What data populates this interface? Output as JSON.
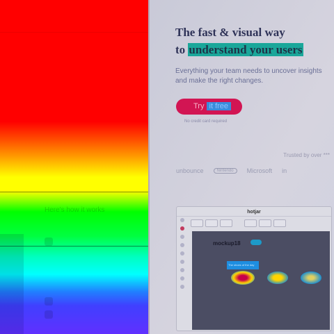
{
  "left_panel": {
    "section_title": "Here's how it works"
  },
  "hero": {
    "title_line1": "The fast & visual way",
    "title_line2_prefix": "to ",
    "title_line2_highlight": "understand your users",
    "subtitle": "Everything your team needs to uncover insights and make the right changes.",
    "cta_prefix": "Try ",
    "cta_highlight": "it free",
    "cta_note": "No credit card required"
  },
  "trusted": {
    "label": "Trusted by over ***",
    "logos": [
      "unbounce",
      "Nintendo",
      "Microsoft",
      "in"
    ]
  },
  "app_preview": {
    "title": "hotjar",
    "brand": "mockup18",
    "tooltip": "The shoes of the day"
  },
  "colors": {
    "cta": "#d21553",
    "highlight": "#1aa79a",
    "heading": "#2f3358"
  }
}
